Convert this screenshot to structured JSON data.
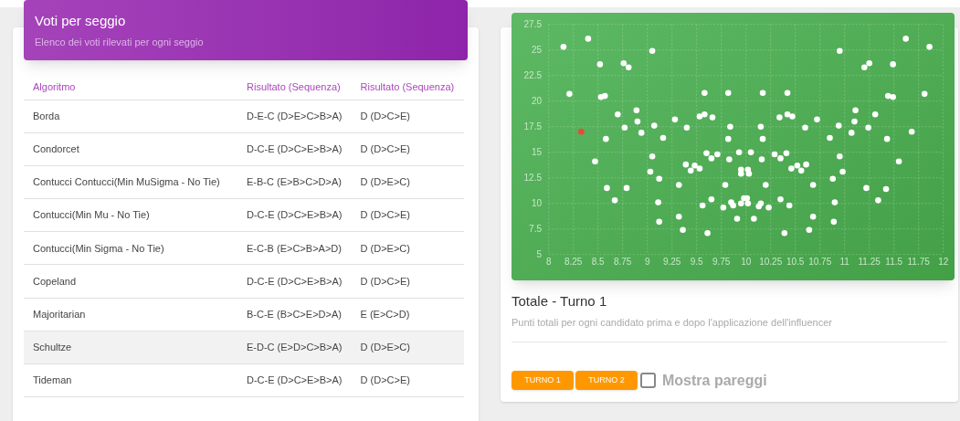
{
  "table_card": {
    "title": "Voti per seggio",
    "subtitle": "Elenco dei voti rilevati per ogni seggio",
    "columns": [
      "Algoritmo",
      "Risultato (Sequenza)",
      "Risultato (Sequenza)"
    ],
    "rows": [
      {
        "cells": [
          "Borda",
          "D-E-C (D>E>C>B>A)",
          "D (D>C>E)"
        ],
        "highlighted": false
      },
      {
        "cells": [
          "Condorcet",
          "D-C-E (D>C>E>B>A)",
          "D (D>C>E)"
        ],
        "highlighted": false
      },
      {
        "cells": [
          "Contucci Contucci(Min MuSigma - No Tie)",
          "E-B-C (E>B>C>D>A)",
          "D (D>E>C)"
        ],
        "highlighted": false
      },
      {
        "cells": [
          "Contucci(Min Mu - No Tie)",
          "D-C-E (D>C>E>B>A)",
          "D (D>C>E)"
        ],
        "highlighted": false
      },
      {
        "cells": [
          "Contucci(Min Sigma - No Tie)",
          "E-C-B (E>C>B>A>D)",
          "D (D>E>C)"
        ],
        "highlighted": false
      },
      {
        "cells": [
          "Copeland",
          "D-C-E (D>C>E>B>A)",
          "D (D>C>E)"
        ],
        "highlighted": false
      },
      {
        "cells": [
          "Majoritarian",
          "B-C-E (B>C>E>D>A)",
          "E (E>C>D)"
        ],
        "highlighted": false
      },
      {
        "cells": [
          "Schultze",
          "E-D-C (E>D>C>B>A)",
          "D (D>E>C)"
        ],
        "highlighted": true
      },
      {
        "cells": [
          "Tideman",
          "D-C-E (D>C>E>B>A)",
          "D (D>C>E)"
        ],
        "highlighted": false
      }
    ]
  },
  "chart_card": {
    "title": "Totale - Turno 1",
    "subtitle": "Punti totali per ogni candidato prima e dopo l'applicazione dell'influencer",
    "chart_data": {
      "type": "scatter",
      "grid": true,
      "xlim": [
        8,
        12
      ],
      "ylim": [
        5,
        27.5
      ],
      "xticks": [
        {
          "value": 8,
          "label": "8"
        },
        {
          "value": 8.25,
          "label": "8.25"
        },
        {
          "value": 8.5,
          "label": "8.5"
        },
        {
          "value": 8.75,
          "label": "8.75"
        },
        {
          "value": 9,
          "label": "9"
        },
        {
          "value": 9.25,
          "label": "9.25"
        },
        {
          "value": 9.5,
          "label": "9.5"
        },
        {
          "value": 9.75,
          "label": "9.75"
        },
        {
          "value": 10,
          "label": "10"
        },
        {
          "value": 10.25,
          "label": "10.25"
        },
        {
          "value": 10.5,
          "label": "10.5"
        },
        {
          "value": 10.75,
          "label": "10.75"
        },
        {
          "value": 11,
          "label": "11"
        },
        {
          "value": 11.25,
          "label": "11.25"
        },
        {
          "value": 11.5,
          "label": "11.5"
        },
        {
          "value": 11.75,
          "label": "11.75"
        },
        {
          "value": 12,
          "label": "12"
        }
      ],
      "yticks": [
        {
          "value": 5,
          "label": "5"
        },
        {
          "value": 7.5,
          "label": "7.5"
        },
        {
          "value": 10,
          "label": "10"
        },
        {
          "value": 12.5,
          "label": "12.5"
        },
        {
          "value": 15,
          "label": "15"
        },
        {
          "value": 17.5,
          "label": "17.5"
        },
        {
          "value": 20,
          "label": "20"
        },
        {
          "value": 22.5,
          "label": "22.5"
        },
        {
          "value": 25,
          "label": "25"
        },
        {
          "value": 27.5,
          "label": "27.5"
        }
      ],
      "series": [
        {
          "color": "#ffffff",
          "x": [
            8.15,
            8.4,
            8.21,
            8.52,
            8.76,
            8.81,
            9.05,
            8.53,
            8.57,
            8.7,
            8.89,
            8.9,
            8.77,
            8.94,
            8.58,
            8.47,
            9.07,
            9.16,
            9.28,
            9.4,
            9.05,
            9.03,
            9.12,
            8.59,
            8.79,
            8.67,
            9.11,
            9.12,
            9.32,
            9.32,
            9.36,
            9.39,
            9.44,
            9.48,
            9.53,
            9.58,
            9.58,
            9.53,
            9.66,
            9.6,
            9.65,
            9.71,
            9.56,
            9.65,
            9.61,
            9.82,
            9.84,
            9.82,
            9.83,
            9.79,
            9.77,
            9.85,
            9.87,
            9.91,
            9.93,
            10.05,
            10.17,
            10.42,
            10.34,
            10.42,
            10.47,
            10.72,
            10.6,
            10.15,
            10.17,
            10.16,
            10.29,
            10.35,
            10.41,
            9.95,
            10.02,
            9.95,
            10.03,
            10.46,
            10.52,
            10.56,
            10.61,
            10.2,
            10.68,
            9.98,
            10.01,
            9.95,
            10.02,
            10.13,
            10.15,
            10.23,
            10.35,
            10.44,
            10.08,
            10.39,
            10.68,
            10.64,
            10.95,
            11.2,
            11.25,
            11.49,
            11.62,
            11.86,
            11.44,
            11.49,
            11.81,
            11.11,
            11.31,
            11.1,
            10.94,
            10.85,
            11.07,
            11.24,
            11.43,
            11.68,
            10.95,
            11.55,
            10.98,
            10.88,
            11.22,
            11.42,
            11.34,
            10.9,
            10.89
          ],
          "values": [
            25.3,
            26.1,
            20.7,
            23.6,
            23.7,
            23.3,
            24.9,
            20.4,
            20.5,
            18.7,
            19.1,
            18.0,
            17.4,
            16.9,
            16.3,
            14.1,
            17.6,
            16.4,
            18.2,
            17.4,
            14.6,
            13.1,
            12.4,
            11.5,
            11.5,
            10.3,
            10.1,
            8.2,
            11.8,
            8.7,
            7.4,
            13.8,
            13.2,
            13.7,
            13.4,
            20.8,
            18.7,
            18.5,
            18.4,
            14.9,
            14.4,
            14.8,
            9.8,
            10.4,
            7.1,
            20.8,
            17.5,
            16.3,
            14.3,
            11.8,
            9.6,
            10.1,
            9.8,
            8.5,
            15.0,
            15.0,
            20.8,
            20.8,
            18.4,
            18.7,
            18.5,
            18.2,
            17.4,
            17.5,
            16.3,
            14.3,
            14.8,
            14.4,
            14.9,
            13.3,
            13.3,
            12.9,
            12.9,
            13.4,
            13.7,
            13.2,
            13.8,
            11.8,
            11.8,
            10.5,
            10.5,
            10.0,
            10.0,
            9.7,
            10.0,
            9.6,
            10.4,
            9.8,
            8.5,
            7.1,
            8.7,
            7.4,
            24.9,
            23.3,
            23.7,
            23.6,
            26.1,
            25.3,
            20.5,
            20.4,
            20.7,
            19.1,
            18.7,
            18.0,
            17.6,
            16.4,
            16.9,
            17.4,
            16.3,
            17.0,
            14.6,
            14.1,
            13.1,
            12.4,
            11.5,
            11.4,
            10.3,
            10.1,
            8.2
          ]
        },
        {
          "color": "#f44336",
          "x": [
            8.33
          ],
          "values": [
            17.0
          ]
        }
      ]
    },
    "buttons": [
      {
        "label": "TURNO 1"
      },
      {
        "label": "TURNO 2"
      }
    ],
    "tie_checkbox": {
      "label": "Mostra pareggi",
      "checked": false
    }
  }
}
